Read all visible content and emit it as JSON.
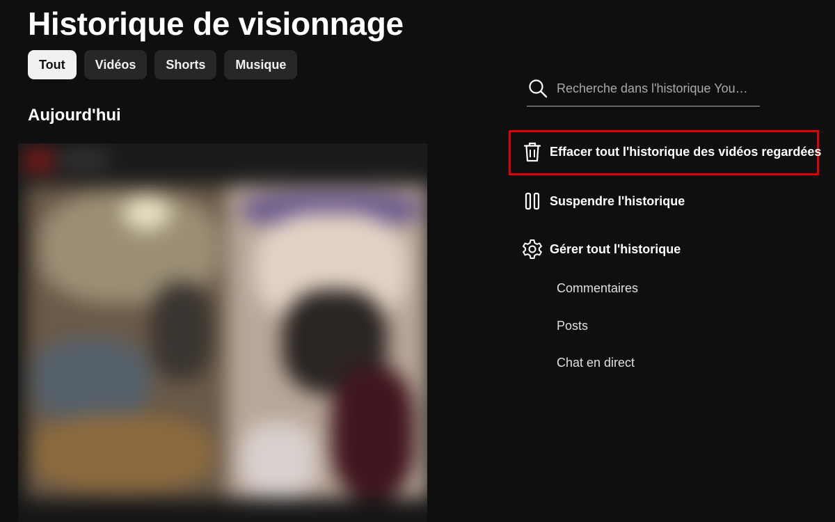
{
  "page": {
    "title": "Historique de visionnage",
    "section_title": "Aujourd'hui"
  },
  "filters": {
    "chips": [
      {
        "label": "Tout",
        "active": true
      },
      {
        "label": "Vidéos",
        "active": false
      },
      {
        "label": "Shorts",
        "active": false
      },
      {
        "label": "Musique",
        "active": false
      }
    ]
  },
  "search": {
    "icon": "search-icon",
    "placeholder": "Recherche dans l'historique You…"
  },
  "actions": {
    "clear_history": {
      "label": "Effacer tout l'historique des vidéos regardées",
      "icon": "trash-icon",
      "highlighted": true,
      "highlight_color": "#e00000"
    },
    "pause_history": {
      "label": "Suspendre l'historique",
      "icon": "pause-icon"
    },
    "manage_history": {
      "label": "Gérer tout l'historique",
      "icon": "gear-icon"
    }
  },
  "manage_links": [
    {
      "label": "Commentaires"
    },
    {
      "label": "Posts"
    },
    {
      "label": "Chat en direct"
    }
  ],
  "colors": {
    "background": "#0f0f0f",
    "chip": "#272727",
    "chip_active": "#f1f1f1",
    "highlight": "#e00000"
  }
}
